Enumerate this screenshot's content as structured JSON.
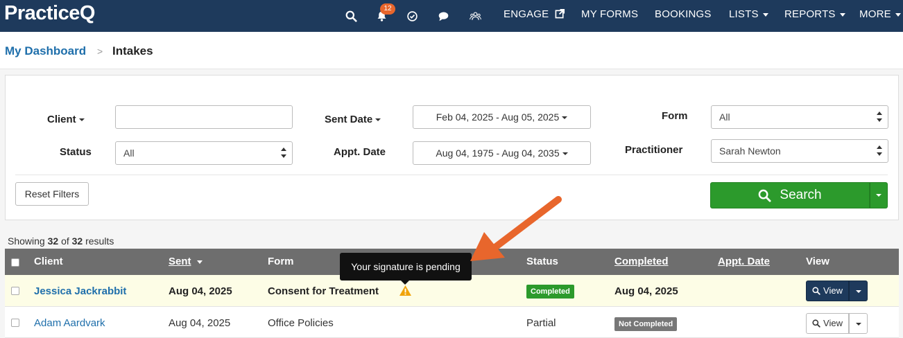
{
  "brand": {
    "logo": "PracticeQ"
  },
  "nav": {
    "icons": [
      "search-icon",
      "bell-icon",
      "check-circle-icon",
      "chat-icon",
      "people-icon"
    ],
    "notification_count": "12",
    "engage": "ENGAGE",
    "my_forms": "MY FORMS",
    "bookings": "BOOKINGS",
    "lists": "LISTS",
    "reports": "REPORTS",
    "more": "MORE"
  },
  "breadcrumb": {
    "parent": "My Dashboard",
    "separator": ">",
    "current": "Intakes"
  },
  "filters": {
    "client_label": "Client",
    "client_value": "",
    "sent_date_label": "Sent Date",
    "sent_date_value": "Feb 04, 2025 - Aug 05, 2025",
    "form_label": "Form",
    "form_value": "All",
    "status_label": "Status",
    "status_value": "All",
    "appt_date_label": "Appt. Date",
    "appt_date_value": "Aug 04, 1975 - Aug 04, 2035",
    "practitioner_label": "Practitioner",
    "practitioner_value": "Sarah Newton",
    "reset_label": "Reset Filters",
    "search_label": "Search"
  },
  "results": {
    "prefix": "Showing",
    "shown": "32",
    "of": "of",
    "total": "32",
    "suffix": "results"
  },
  "table": {
    "columns": {
      "client": "Client",
      "sent": "Sent",
      "form": "Form",
      "status": "Status",
      "completed": "Completed",
      "appt_date": "Appt. Date",
      "view": "View"
    },
    "rows": [
      {
        "client": "Jessica Jackrabbit",
        "sent": "Aug 04, 2025",
        "form": "Consent for Treatment",
        "status": "",
        "status_badge": "Completed",
        "completed": "Aug 04, 2025",
        "appt_date": "",
        "view": "View"
      },
      {
        "client": "Adam Aardvark",
        "sent": "Aug 04, 2025",
        "form": "Office Policies",
        "status": "Partial",
        "status_badge": "Not Completed",
        "completed": "",
        "appt_date": "",
        "view": "View"
      }
    ]
  },
  "tooltip": {
    "text": "Your signature is pending"
  },
  "colors": {
    "navbar": "#1e3a5c",
    "link": "#1f6fab",
    "search_button": "#2c9a2c",
    "completed_badge": "#2c9a2c",
    "not_completed_badge": "#777777",
    "highlight_row": "#fdfde6",
    "annotation_arrow": "#e8662c",
    "warning": "#f0a30a"
  }
}
